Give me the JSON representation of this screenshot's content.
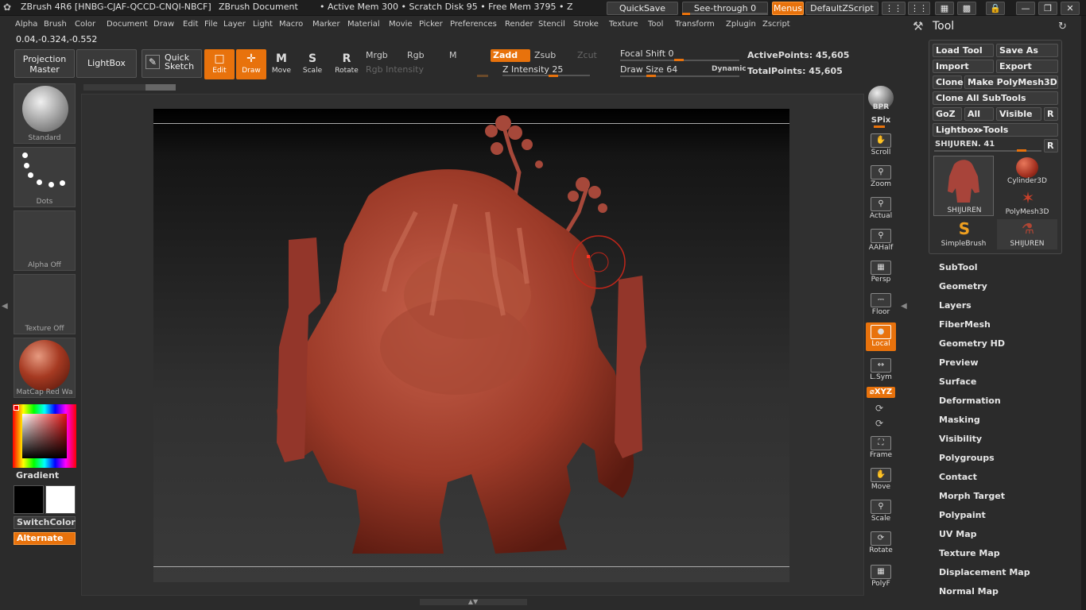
{
  "titlebar": {
    "app": "ZBrush 4R6  [HNBG-CJAF-QCCD-CNQI-NBCF]",
    "doc": "ZBrush Document",
    "mem": "• Active Mem 300  • Scratch Disk 95  • Free Mem 3795  • Z",
    "quicksave": "QuickSave",
    "seethrough": "See-through   0",
    "menus": "Menus",
    "defaultzscript": "DefaultZScript"
  },
  "menubar": [
    "Alpha",
    "Brush",
    "Color",
    "Document",
    "Draw",
    "Edit",
    "File",
    "Layer",
    "Light",
    "Macro",
    "Marker",
    "Material",
    "Movie",
    "Picker",
    "Preferences",
    "Render",
    "Stencil",
    "Stroke",
    "Texture",
    "Tool",
    "Transform",
    "Zplugin",
    "Zscript"
  ],
  "coords": "0.04,-0.324,-0.552",
  "shelf": {
    "projection_master": "Projection Master",
    "lightbox": "LightBox",
    "quick_sketch": "Quick Sketch",
    "edit": "Edit",
    "draw": "Draw",
    "move": "Move",
    "scale": "Scale",
    "rotate": "Rotate",
    "mrgb": "Mrgb",
    "rgb": "Rgb",
    "m": "M",
    "zadd": "Zadd",
    "zsub": "Zsub",
    "zcut": "Zcut",
    "rgb_intensity": "Rgb  Intensity",
    "z_intensity": "Z  Intensity 25",
    "focal_shift": "Focal Shift 0",
    "draw_size": "Draw Size 64",
    "dynamic": "Dynamic",
    "active_points": "ActivePoints: 45,605",
    "total_points": "TotalPoints: 45,605"
  },
  "left": {
    "brush": "Standard",
    "stroke": "Dots",
    "alpha": "Alpha  Off",
    "texture": "Texture  Off",
    "material": "MatCap  Red  Wa",
    "gradient": "Gradient",
    "switchcolor": "SwitchColor",
    "alternate": "Alternate"
  },
  "rightshelf": {
    "bpr": "BPR",
    "spix": "SPix",
    "scroll": "Scroll",
    "zoom": "Zoom",
    "actual": "Actual",
    "aahalf": "AAHalf",
    "persp": "Persp",
    "floor": "Floor",
    "local": "Local",
    "lsym": "L.Sym",
    "xyz": "⌀XYZ",
    "frame": "Frame",
    "move": "Move",
    "scale": "Scale",
    "rotate": "Rotate",
    "polyf": "PolyF"
  },
  "tool": {
    "title": "Tool",
    "load_tool": "Load Tool",
    "save_as": "Save As",
    "import": "Import",
    "export": "Export",
    "clone": "Clone",
    "make_polymesh": "Make PolyMesh3D",
    "clone_all": "Clone  All  SubTools",
    "goz": "GoZ",
    "all": "All",
    "visible": "Visible",
    "r": "R",
    "lightbox_tools": "Lightbox▸Tools",
    "current": "SHIJUREN. 41",
    "r2": "R",
    "thumbs": [
      "SHIJUREN",
      "Cylinder3D",
      "PolyMesh3D",
      "SimpleBrush",
      "SHIJUREN"
    ],
    "items": [
      "SubTool",
      "Geometry",
      "Layers",
      "FiberMesh",
      "Geometry HD",
      "Preview",
      "Surface",
      "Deformation",
      "Masking",
      "Visibility",
      "Polygroups",
      "Contact",
      "Morph Target",
      "Polypaint",
      "UV Map",
      "Texture Map",
      "Displacement Map",
      "Normal Map"
    ]
  }
}
